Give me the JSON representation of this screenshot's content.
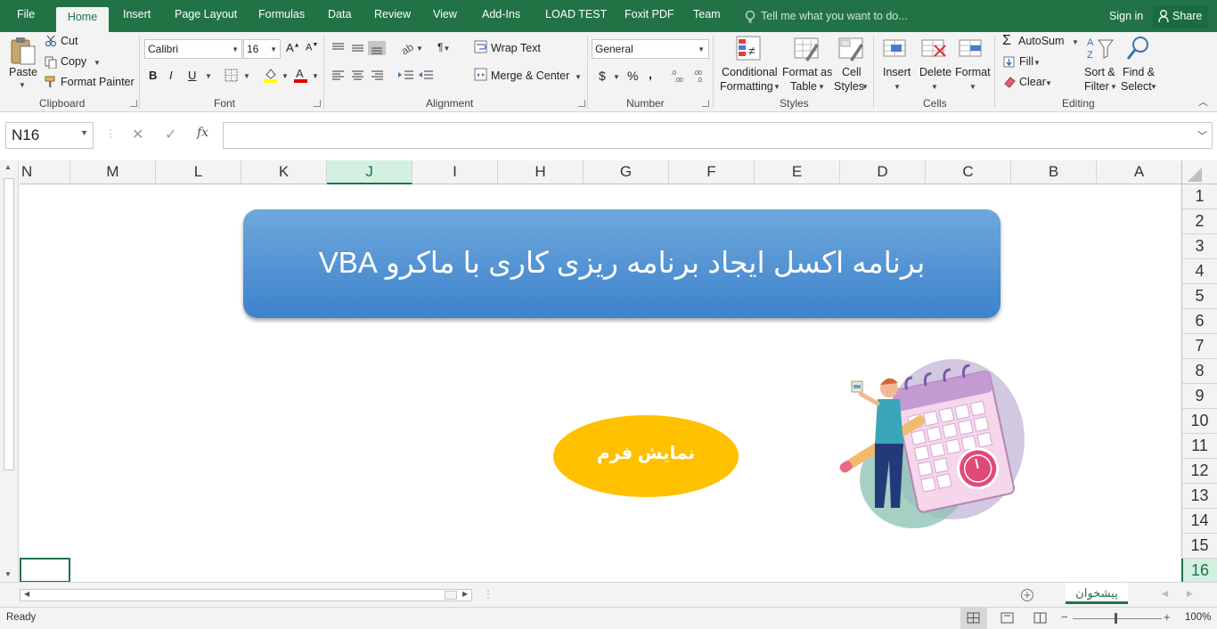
{
  "tabs": {
    "file": "File",
    "home": "Home",
    "insert": "Insert",
    "page_layout": "Page Layout",
    "formulas": "Formulas",
    "data": "Data",
    "review": "Review",
    "view": "View",
    "addins": "Add-Ins",
    "load_test": "LOAD TEST",
    "foxit": "Foxit PDF",
    "team": "Team"
  },
  "tell_me": "Tell me what you want to do...",
  "sign_in": "Sign in",
  "share": "Share",
  "ribbon": {
    "clipboard": {
      "label": "Clipboard",
      "paste": "Paste",
      "cut": "Cut",
      "copy": "Copy",
      "format_painter": "Format Painter"
    },
    "font": {
      "label": "Font",
      "name": "Calibri",
      "size": "16",
      "bold": "B",
      "italic": "I",
      "underline": "U"
    },
    "alignment": {
      "label": "Alignment",
      "wrap_text": "Wrap Text",
      "merge_center": "Merge & Center"
    },
    "number": {
      "label": "Number",
      "format": "General",
      "currency": "$",
      "percent": "%",
      "comma": ","
    },
    "styles": {
      "label": "Styles",
      "conditional": "Conditional",
      "formatting": "Formatting",
      "format_as": "Format as",
      "table": "Table",
      "cell": "Cell",
      "styles_word": "Styles"
    },
    "cells": {
      "label": "Cells",
      "insert": "Insert",
      "delete": "Delete",
      "format": "Format"
    },
    "editing": {
      "label": "Editing",
      "autosum": "AutoSum",
      "fill": "Fill",
      "clear": "Clear",
      "sort": "Sort &",
      "filter": "Filter",
      "find": "Find &",
      "select": "Select"
    }
  },
  "name_box": "N16",
  "formula_value": "",
  "columns": [
    "N",
    "M",
    "L",
    "K",
    "J",
    "I",
    "H",
    "G",
    "F",
    "E",
    "D",
    "C",
    "B",
    "A"
  ],
  "selected_column": "J",
  "rows": [
    "1",
    "2",
    "3",
    "4",
    "5",
    "6",
    "7",
    "8",
    "9",
    "10",
    "11",
    "12",
    "13",
    "14",
    "15",
    "16"
  ],
  "selected_row": "16",
  "banner_text": "برنامه اکسل ایجاد برنامه ریزی کاری با ماکرو VBA",
  "button_text": "نمایش فرم",
  "sheet_tab": "پیشخوان",
  "status": "Ready",
  "zoom": "100%",
  "colors": {
    "brand": "#217346",
    "banner": "#4a8fd6",
    "button": "#ffc000"
  }
}
